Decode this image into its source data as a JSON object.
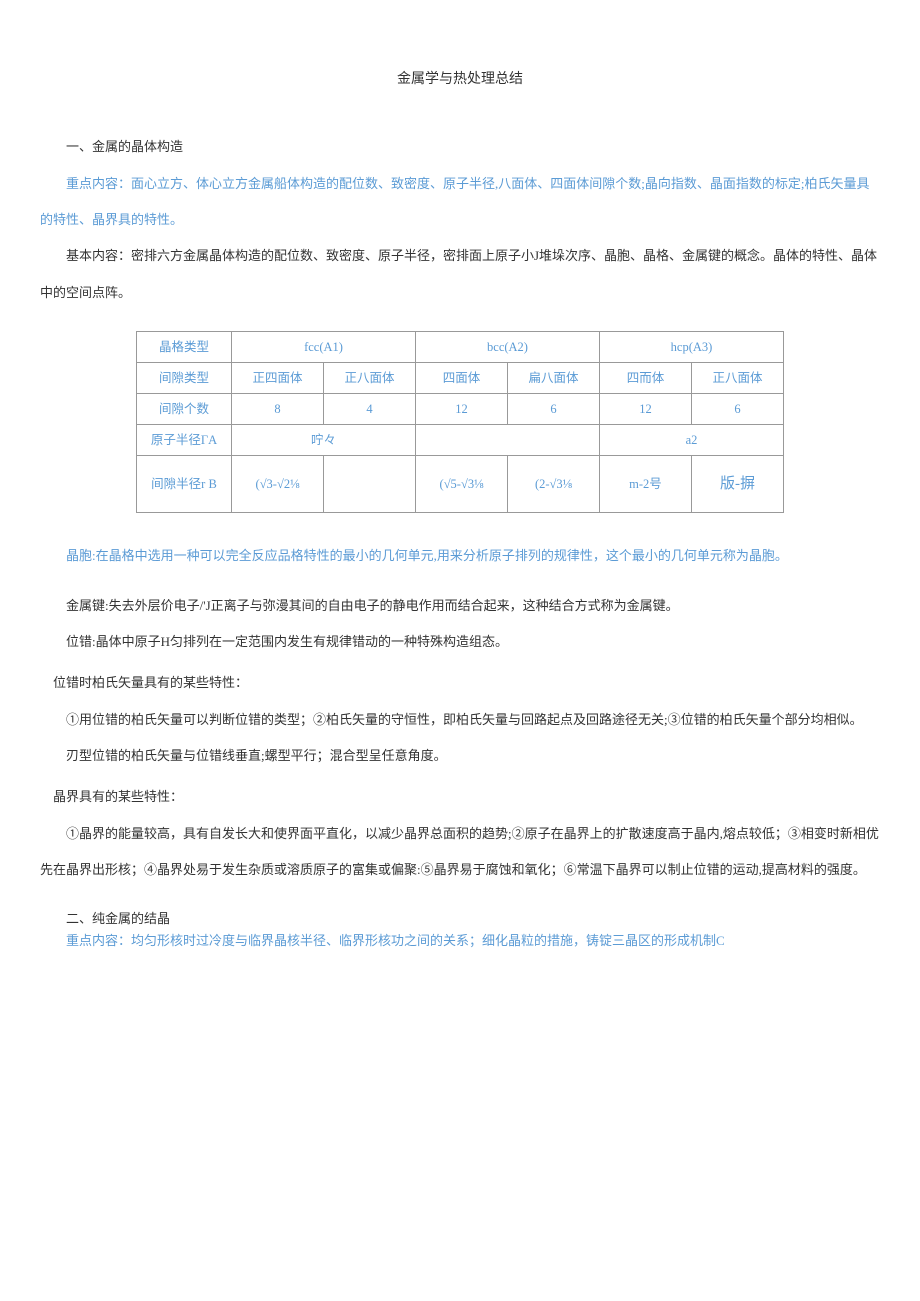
{
  "title": "金属学与热处理总结",
  "s1_heading": "一、金属的晶体构造",
  "s1_p1": "重点内容：面心立方、体心立方金属船体构造的配位数、致密度、原子半径,八面体、四面体间隙个数;晶向指数、晶面指数的标定;柏氏矢量具的特性、晶界具的特性。",
  "s1_p2": "基本内容：密排六方金属晶体构造的配位数、致密度、原子半径，密排面上原子小J堆垛次序、晶胞、晶格、金属键的概念。晶体的特性、晶体中的空间点阵。",
  "table": {
    "r0c0": "晶格类型",
    "r0c1": "fcc(A1)",
    "r0c2": "bcc(A2)",
    "r0c3": "hcp(A3)",
    "r1c0": "间隙类型",
    "r1c1": "正四面体",
    "r1c2": "正八面体",
    "r1c3": "四面体",
    "r1c4": "扁八面体",
    "r1c5": "四而体",
    "r1c6": "正八面体",
    "r2c0": "间隙个数",
    "r2c1": "8",
    "r2c2": "4",
    "r2c3": "12",
    "r2c4": "6",
    "r2c5": "12",
    "r2c6": "6",
    "r3c0": "原子半径ΓA",
    "r3c1": "咛々",
    "r3c2": "",
    "r3c3": "a2",
    "r4c0": "间隙半径r B",
    "r4c1": "(√3-√2⅛",
    "r4c2": "",
    "r4c3": "(√5-√3⅛",
    "r4c4": "(2-√3⅛",
    "r4c5": "m-2号",
    "r4c6": "版-摒"
  },
  "p_cell": "晶胞:在晶格中选用一种可以完全反应品格特性的最小的几何单元,用来分析原子排列的规律性，这个最小的几何单元称为晶胞。",
  "p_bond": "金属键:失去外层价电子/'J正离子与弥漫其间的自由电子的静电作用而结合起来，这种结合方式称为金属键。",
  "p_dislocation": "位错:晶体中原子H匀排列在一定范围内发生有规律错动的一种特殊构造组态。",
  "h_burgers": "位错时柏氏矢量具有的某些特性：",
  "p_burgers": "①用位错的柏氏矢量可以判断位错的类型；②柏氏矢量的守恒性，即柏氏矢量与回路起点及回路途径无关;③位错的柏氏矢量个部分均相似。",
  "p_edge": "刃型位错的柏氏矢量与位错线垂直;螺型平行；混合型呈任意角度。",
  "h_boundary": "晶界具有的某些特性：",
  "p_boundary": "①晶界的能量较高，具有自发长大和使界面平直化，以减少晶界总面积的趋势;②原子在晶界上的扩散速度高于晶内,熔点较低；③相变时新相优先在晶界出形核；④晶界处易于发生杂质或溶质原子的富集或偏聚:⑤晶界易于腐蚀和氧化；⑥常温下晶界可以制止位错的运动,提高材料的强度。",
  "s2_heading": "二、纯金属的结晶",
  "s2_note": "重点内容：均匀形核时过冷度与临界晶核半径、临界形核功之间的关系；细化晶粒的措施，铸锭三晶区的形成机制C"
}
